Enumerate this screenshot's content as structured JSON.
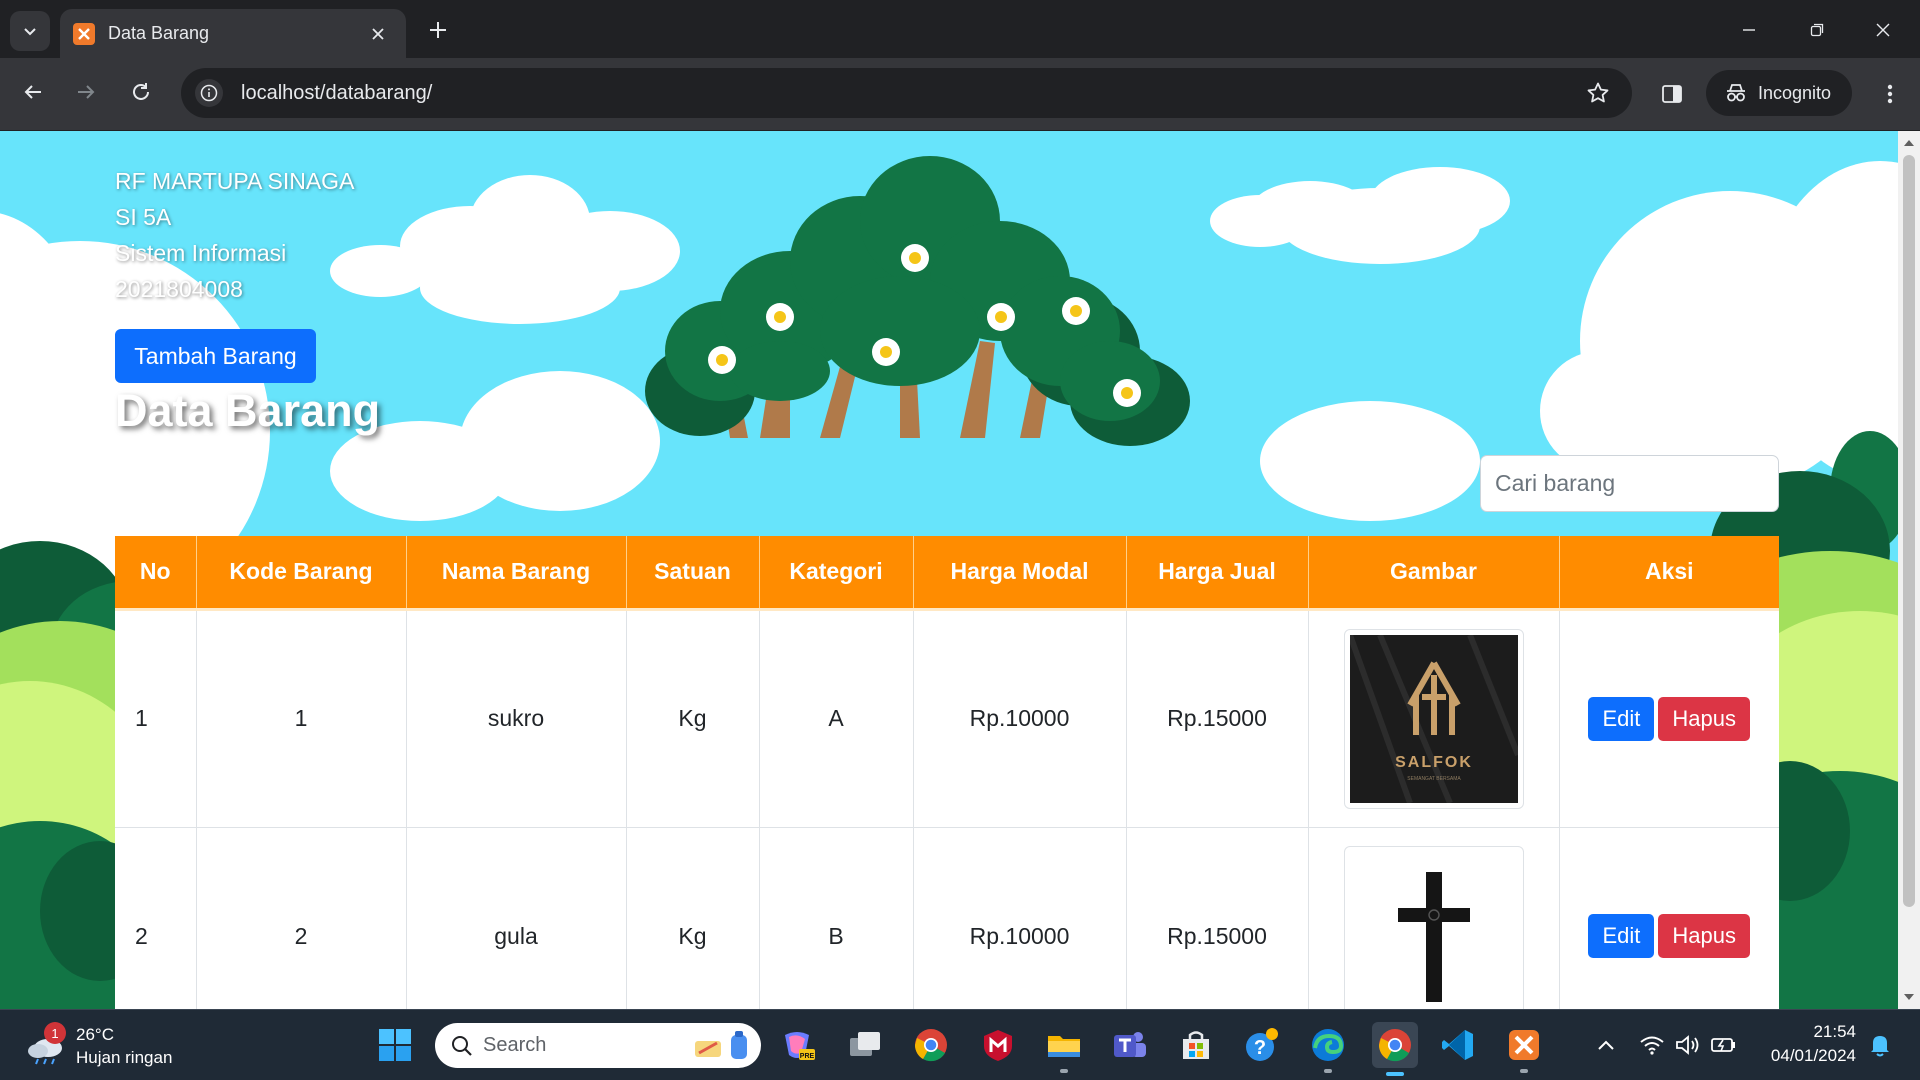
{
  "browser": {
    "tab_title": "Data Barang",
    "url": "localhost/databarang/",
    "profile_label": "Incognito"
  },
  "page": {
    "author_lines": [
      "RF MARTUPA SINAGA",
      "SI 5A",
      "Sistem Informasi",
      "2021804008"
    ],
    "add_button_label": "Tambah Barang",
    "heading": "Data Barang",
    "search_placeholder": "Cari barang"
  },
  "table": {
    "headers": [
      "No",
      "Kode Barang",
      "Nama Barang",
      "Satuan",
      "Kategori",
      "Harga Modal",
      "Harga Jual",
      "Gambar",
      "Aksi"
    ],
    "rows": [
      {
        "no": "1",
        "kode": "1",
        "nama": "sukro",
        "satuan": "Kg",
        "kategori": "A",
        "harga_modal": "Rp.10000",
        "harga_jual": "Rp.15000",
        "image_brand": "SALFOK",
        "image_tagline": "SEMANGAT BERSAMA"
      },
      {
        "no": "2",
        "kode": "2",
        "nama": "gula",
        "satuan": "Kg",
        "kategori": "B",
        "harga_modal": "Rp.10000",
        "harga_jual": "Rp.15000"
      }
    ],
    "edit_label": "Edit",
    "delete_label": "Hapus"
  },
  "taskbar": {
    "weather_badge": "1",
    "weather_temp": "26°C",
    "weather_desc": "Hujan ringan",
    "search_label": "Search",
    "time": "21:54",
    "date": "04/01/2024"
  },
  "colors": {
    "header_orange": "#ff8c00",
    "primary_blue": "#0d6efd",
    "danger_red": "#dc3545",
    "sky": "#67e4fb"
  }
}
